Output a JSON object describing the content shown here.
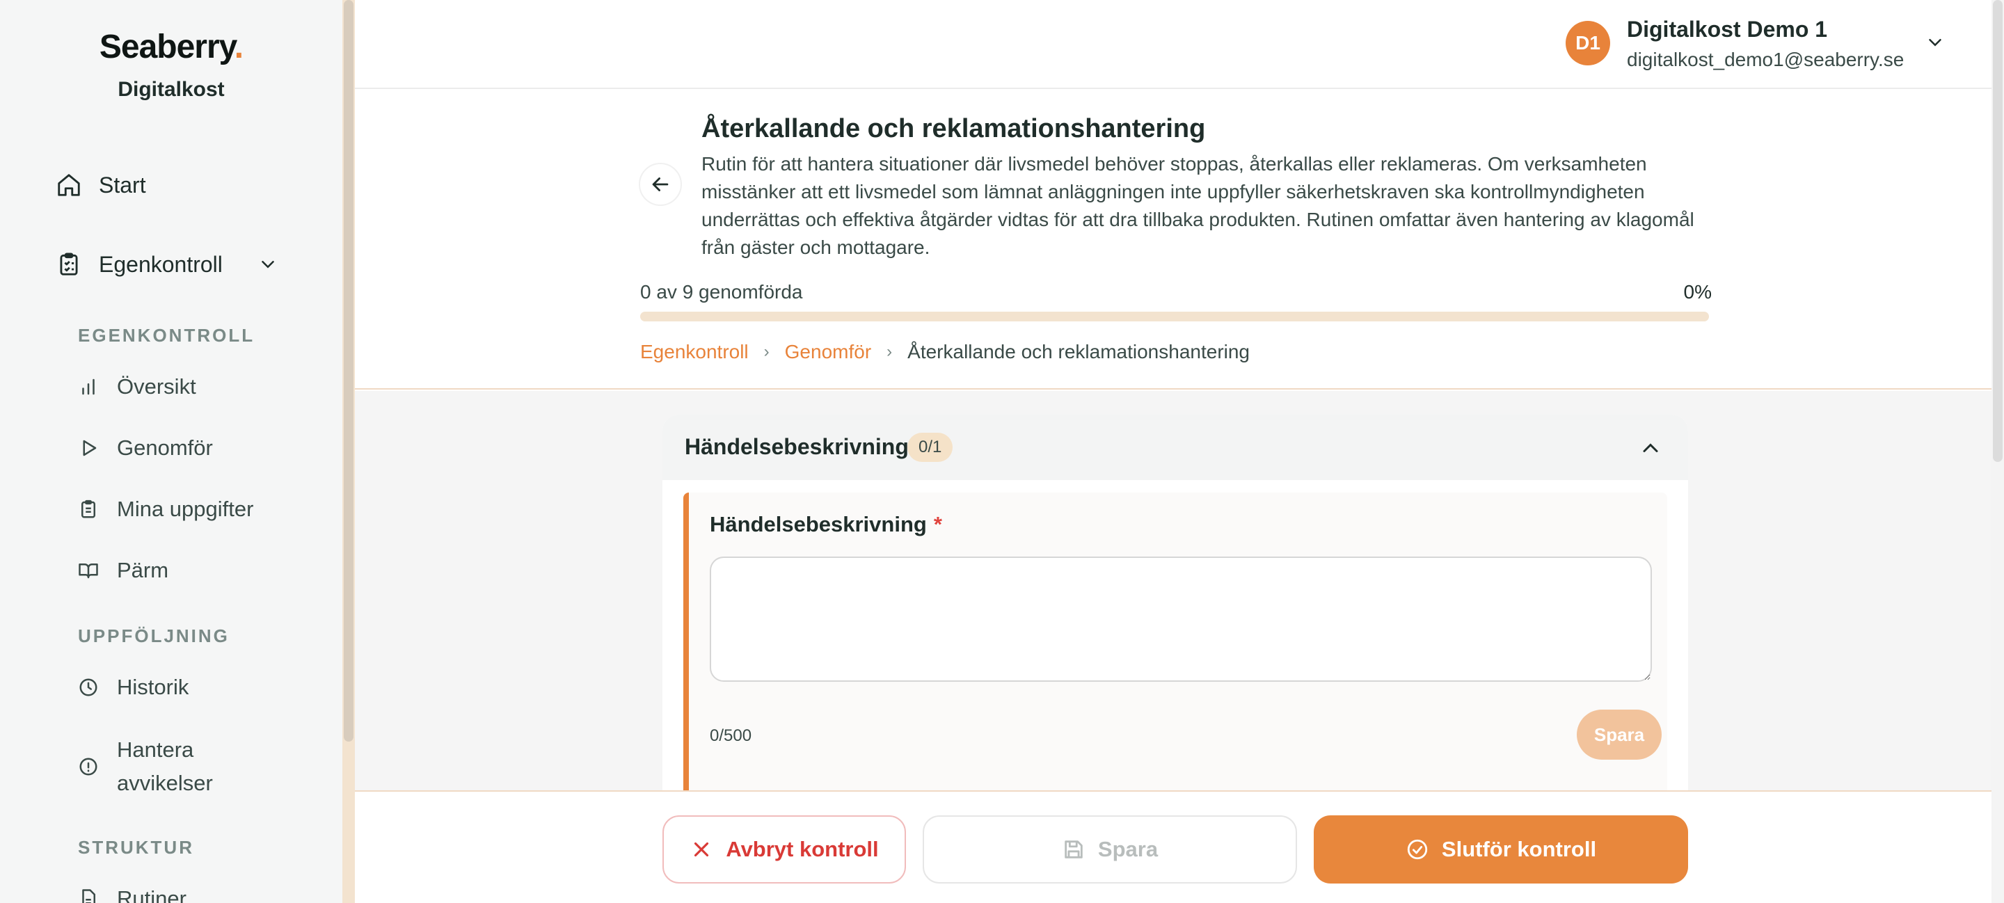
{
  "sidebar": {
    "logo": "Seaberry",
    "logo_dot": ".",
    "org_name": "Digitalkost",
    "nav_start": "Start",
    "nav_egenkontroll": "Egenkontroll",
    "section_egenkontroll": "EGENKONTROLL",
    "item_oversikt": "Översikt",
    "item_genomfor": "Genomför",
    "item_uppgifter": "Mina uppgifter",
    "item_parm": "Pärm",
    "section_uppfoljning": "UPPFÖLJNING",
    "item_historik": "Historik",
    "item_avvikelser_1": "Hantera",
    "item_avvikelser_2": "avvikelser",
    "section_struktur": "STRUKTUR",
    "item_rutiner": "Rutiner"
  },
  "user": {
    "initials": "D1",
    "name": "Digitalkost Demo 1",
    "email": "digitalkost_demo1@seaberry.se"
  },
  "header": {
    "title": "Återkallande och reklamationshantering",
    "description": "Rutin för att hantera situationer där livsmedel behöver stoppas, återkallas eller reklameras. Om verksamheten misstänker att ett livsmedel som lämnat anläggningen inte uppfyller säkerhetskraven ska kontrollmyndigheten underrättas och effektiva åtgärder vidtas för att dra tillbaka produkten. Rutinen omfattar även hantering av klagomål från gäster och mottagare.",
    "progress_label": "0 av 9 genomförda",
    "progress_percent": "0%",
    "progress_value": 0,
    "breadcrumb": {
      "item1": "Egenkontroll",
      "item2": "Genomför",
      "current": "Återkallande och reklamationshantering",
      "separator": "›"
    }
  },
  "section": {
    "title": "Händelsebeskrivning",
    "badge": "0/1",
    "question_label": "Händelsebeskrivning",
    "required_mark": "*",
    "input_value": "",
    "char_count": "0/500",
    "save_label": "Spara"
  },
  "footer": {
    "cancel_label": "Avbryt kontroll",
    "save_label": "Spara",
    "finish_label": "Slutför kontroll"
  },
  "colors": {
    "accent": "#e8833a",
    "danger": "#d93a36"
  }
}
